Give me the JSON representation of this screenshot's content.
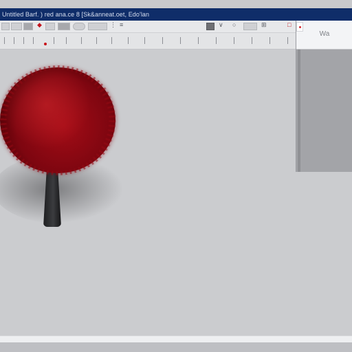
{
  "window": {
    "title": "Untitled Barf. ) red ana.ce 8 [Sk&anneat.oet, Edo'lan"
  },
  "toolbar": {
    "buttons": [
      "new-button",
      "open-button",
      "save-button",
      "print-button",
      "undo-button",
      "redo-button",
      "zoom-button",
      "font-button",
      "color-button",
      "bold-button",
      "italic-button",
      "underline-button"
    ]
  },
  "side_panel": {
    "title": "Wa"
  },
  "canvas": {
    "subject": "red tree",
    "colors": {
      "foliage": "#a30c16",
      "trunk": "#2a2b2e",
      "titlebar": "#0f2d69",
      "background": "#cbcccf"
    }
  },
  "icons": [
    "menu-icon",
    "folder-icon",
    "disk-icon",
    "printer-icon",
    "brush-icon",
    "zoom-icon",
    "text-icon",
    "grid-icon",
    "ruler-icon",
    "close-panel-icon"
  ]
}
